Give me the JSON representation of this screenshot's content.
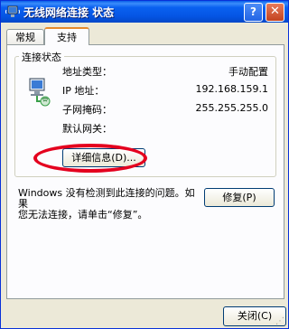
{
  "window": {
    "title": "无线网络连接 状态",
    "help_label": "?",
    "close_label": "✕"
  },
  "tabs": [
    {
      "label": "常规"
    },
    {
      "label": "支持"
    }
  ],
  "connection_status": {
    "group_label": "连接状态",
    "rows": [
      {
        "label": "地址类型：",
        "value": "手动配置"
      },
      {
        "label": "IP 地址：",
        "value": "192.168.159.1"
      },
      {
        "label": "子网掩码：",
        "value": "255.255.255.0"
      },
      {
        "label": "默认网关：",
        "value": ""
      }
    ],
    "details_button": "详细信息(D)..."
  },
  "repair_section": {
    "message_line1": "Windows 没有检测到此连接的问题。如果",
    "message_line2": "您无法连接，请单击“修复”。",
    "repair_button": "修复(P)"
  },
  "footer": {
    "close_button": "关闭(C)"
  },
  "colors": {
    "title_bar": "#0a5fe9",
    "dialog_bg": "#ece9d8",
    "highlight_ellipse": "#e4001e",
    "active_tab_accent": "#e68b2c"
  }
}
